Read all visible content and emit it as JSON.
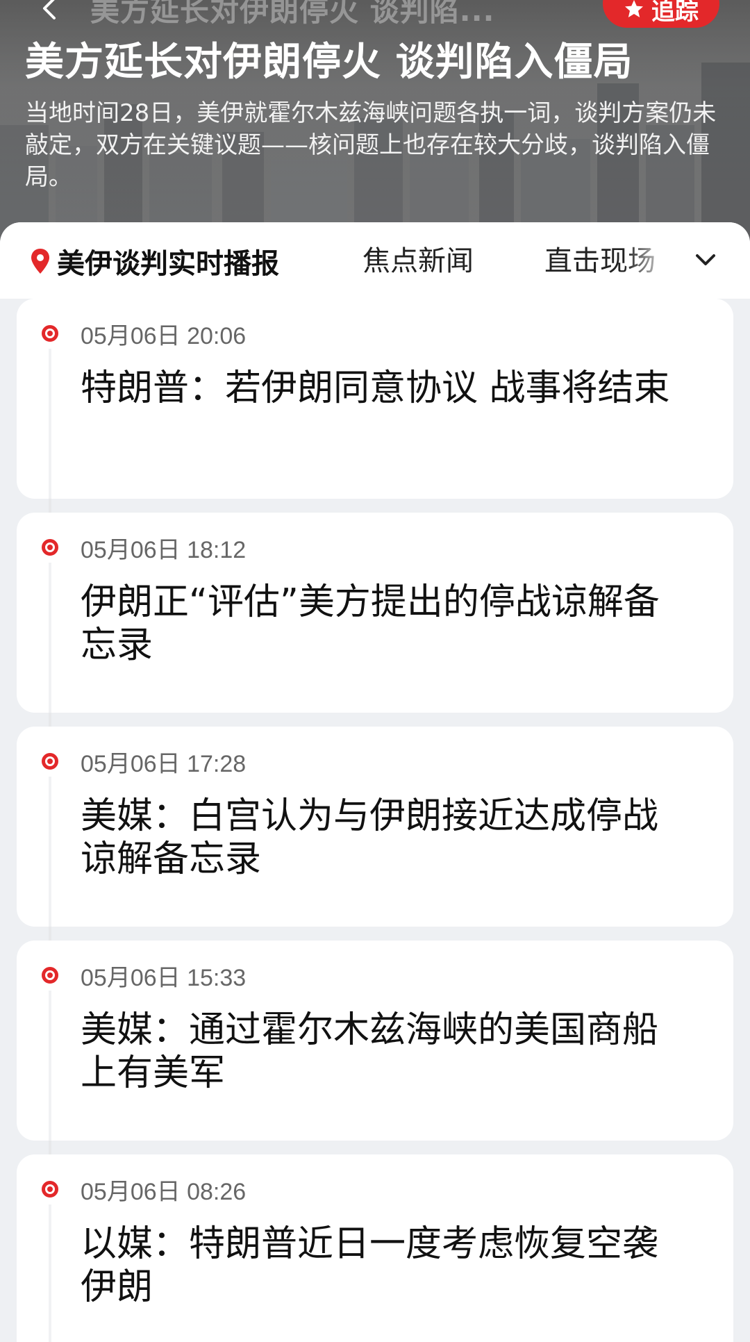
{
  "header": {
    "faded_title": "美方延长对伊朗停火 谈判陷...",
    "follow_label": "追踪",
    "title": "美方延长对伊朗停火 谈判陷入僵局",
    "description": "当地时间28日，美伊就霍尔木兹海峡问题各执一词，谈判方案仍未敲定，双方在关键议题——核问题上也存在较大分歧，谈判陷入僵局。"
  },
  "tabs": {
    "active_label": "美伊谈判实时播报",
    "items": [
      "焦点新闻",
      "直击现场"
    ]
  },
  "timeline": [
    {
      "time": "05月06日 20:06",
      "headline": "特朗普：若伊朗同意协议 战事将结束"
    },
    {
      "time": "05月06日 18:12",
      "headline": "伊朗正“评估”美方提出的停战谅解备忘录"
    },
    {
      "time": "05月06日 17:28",
      "headline": "美媒：白宫认为与伊朗接近达成停战谅解备忘录"
    },
    {
      "time": "05月06日 15:33",
      "headline": "美媒：通过霍尔木兹海峡的美国商船上有美军"
    },
    {
      "time": "05月06日 08:26",
      "headline": "以媒：特朗普近日一度考虑恢复空袭伊朗"
    }
  ],
  "colors": {
    "accent": "#e3282a",
    "background": "#eef0f3",
    "card": "#ffffff"
  },
  "icons": [
    "back-arrow-icon",
    "star-icon",
    "location-pin-icon",
    "chevron-down-icon",
    "timeline-dot-icon"
  ]
}
